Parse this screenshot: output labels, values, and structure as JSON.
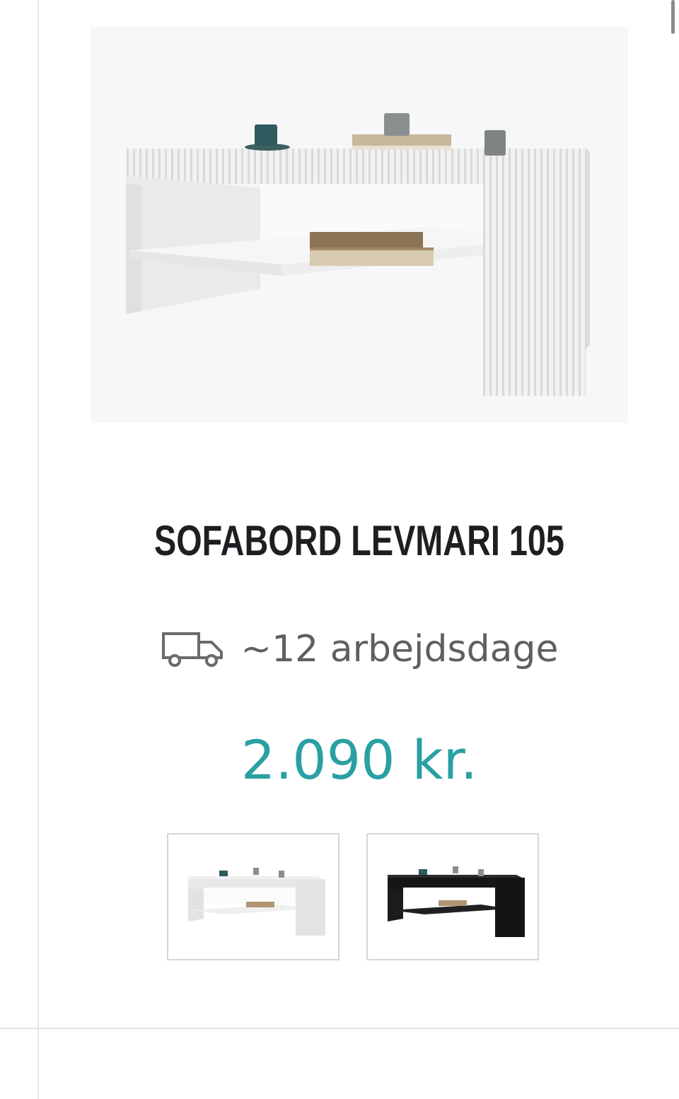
{
  "product": {
    "title": "SOFABORD LEVMARI 105",
    "delivery_text": "~12 arbejdsdage",
    "delivery_icon": "truck-icon",
    "price": "2.090 kr.",
    "price_color": "#2aa0a3"
  },
  "variants": [
    {
      "name": "white",
      "color": "#ffffff"
    },
    {
      "name": "black",
      "color": "#1a1a1a"
    }
  ]
}
